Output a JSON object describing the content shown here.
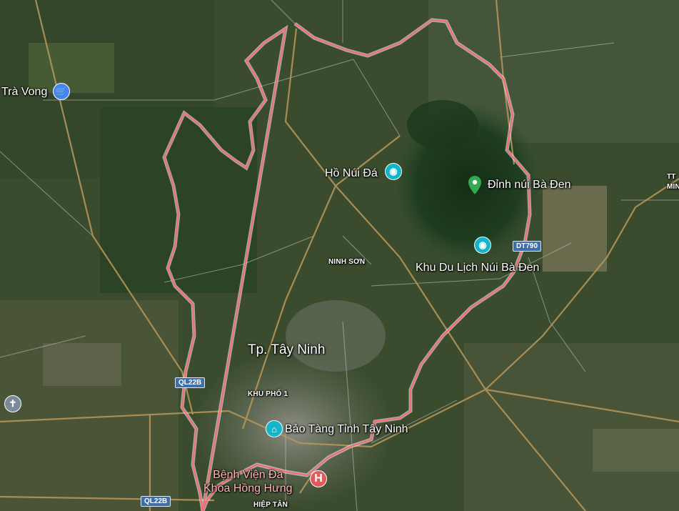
{
  "map": {
    "colors": {
      "boundary": "#ee6f75",
      "road_major": "#b3955a",
      "road_minor": "#c9c9c9",
      "mountain": "#1d3b1f",
      "urban": "#7c7f74"
    },
    "places": {
      "tra_vong": "Trà Vong",
      "ho_nui_da": "Hồ Núi Đá",
      "dinh_nui_ba_den": "Đỉnh núi Bà Đen",
      "khu_du_lich": "Khu Du Lịch Núi Bà Đen",
      "ninh_son": "NINH SƠN",
      "tp_tay_ninh": "Tp. Tây Ninh",
      "khu_pho_1": "KHU PHỐ 1",
      "bao_tang": "Bảo Tàng Tỉnh Tây Ninh",
      "benh_vien_line1": "Bệnh Viện Đa",
      "benh_vien_line2": "Khoa Hồng Hưng",
      "hiep_tan": "HIỆP TÂN",
      "edge_tt": "TT",
      "edge_min": "MIN"
    },
    "shields": {
      "dt790": "DT790",
      "ql22b_upper": "QL22B",
      "ql22b_lower": "QL22B"
    },
    "icons": {
      "tra_vong": "shopping-cart-icon",
      "ho_nui_da": "camera-icon",
      "dinh_nui_ba_den": "green-pin-icon",
      "khu_du_lich": "camera-icon",
      "church": "cross-icon",
      "hospital": "hospital-icon",
      "bao_tang": "museum-icon"
    }
  }
}
